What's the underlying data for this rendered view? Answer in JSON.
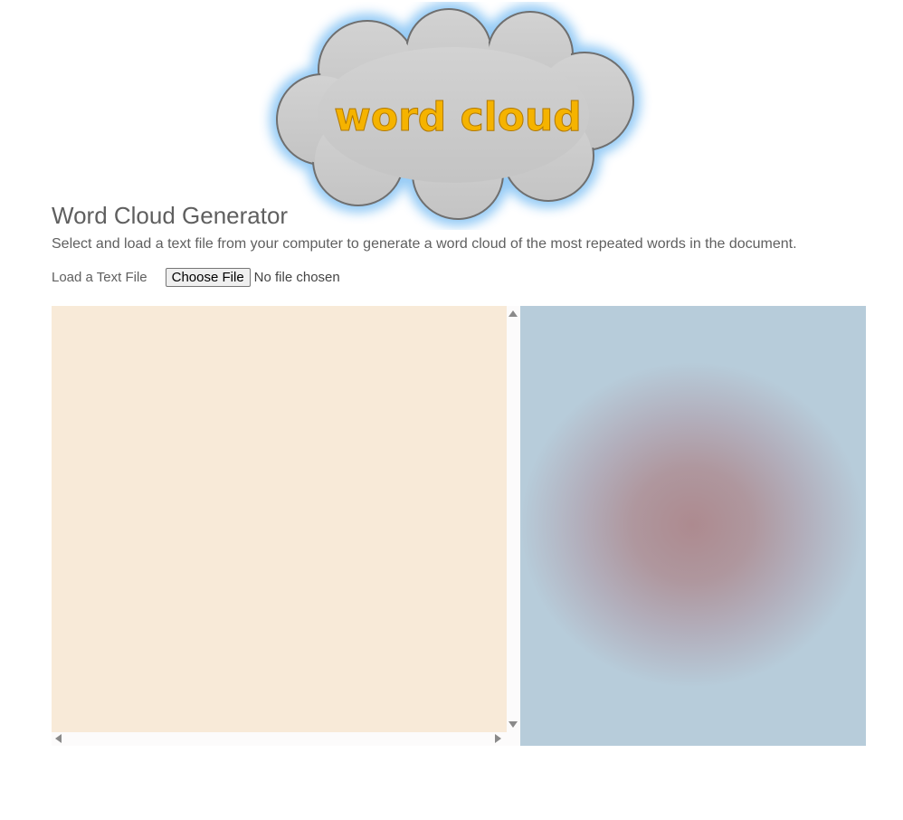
{
  "logo": {
    "text": "word cloud",
    "colors": {
      "cloud": "#cbcbcb",
      "glow": "#8fc8f5",
      "text": "#f5b300"
    }
  },
  "header": {
    "title": "Word Cloud Generator",
    "intro": "Select and load a text file from your computer to generate a word cloud of the most repeated words in the document."
  },
  "file_input": {
    "label": "Load a Text File",
    "button_label": "Choose File",
    "status": "No file chosen"
  },
  "colors": {
    "text_area_bg": "#f8ead8",
    "cloud_canvas_bg": "#b7ccda",
    "cloud_canvas_center": "#ad8a8f",
    "text": "#5f5f5f"
  },
  "icons": [
    "scroll-up-arrow-icon",
    "scroll-down-arrow-icon",
    "scroll-left-arrow-icon",
    "scroll-right-arrow-icon"
  ]
}
